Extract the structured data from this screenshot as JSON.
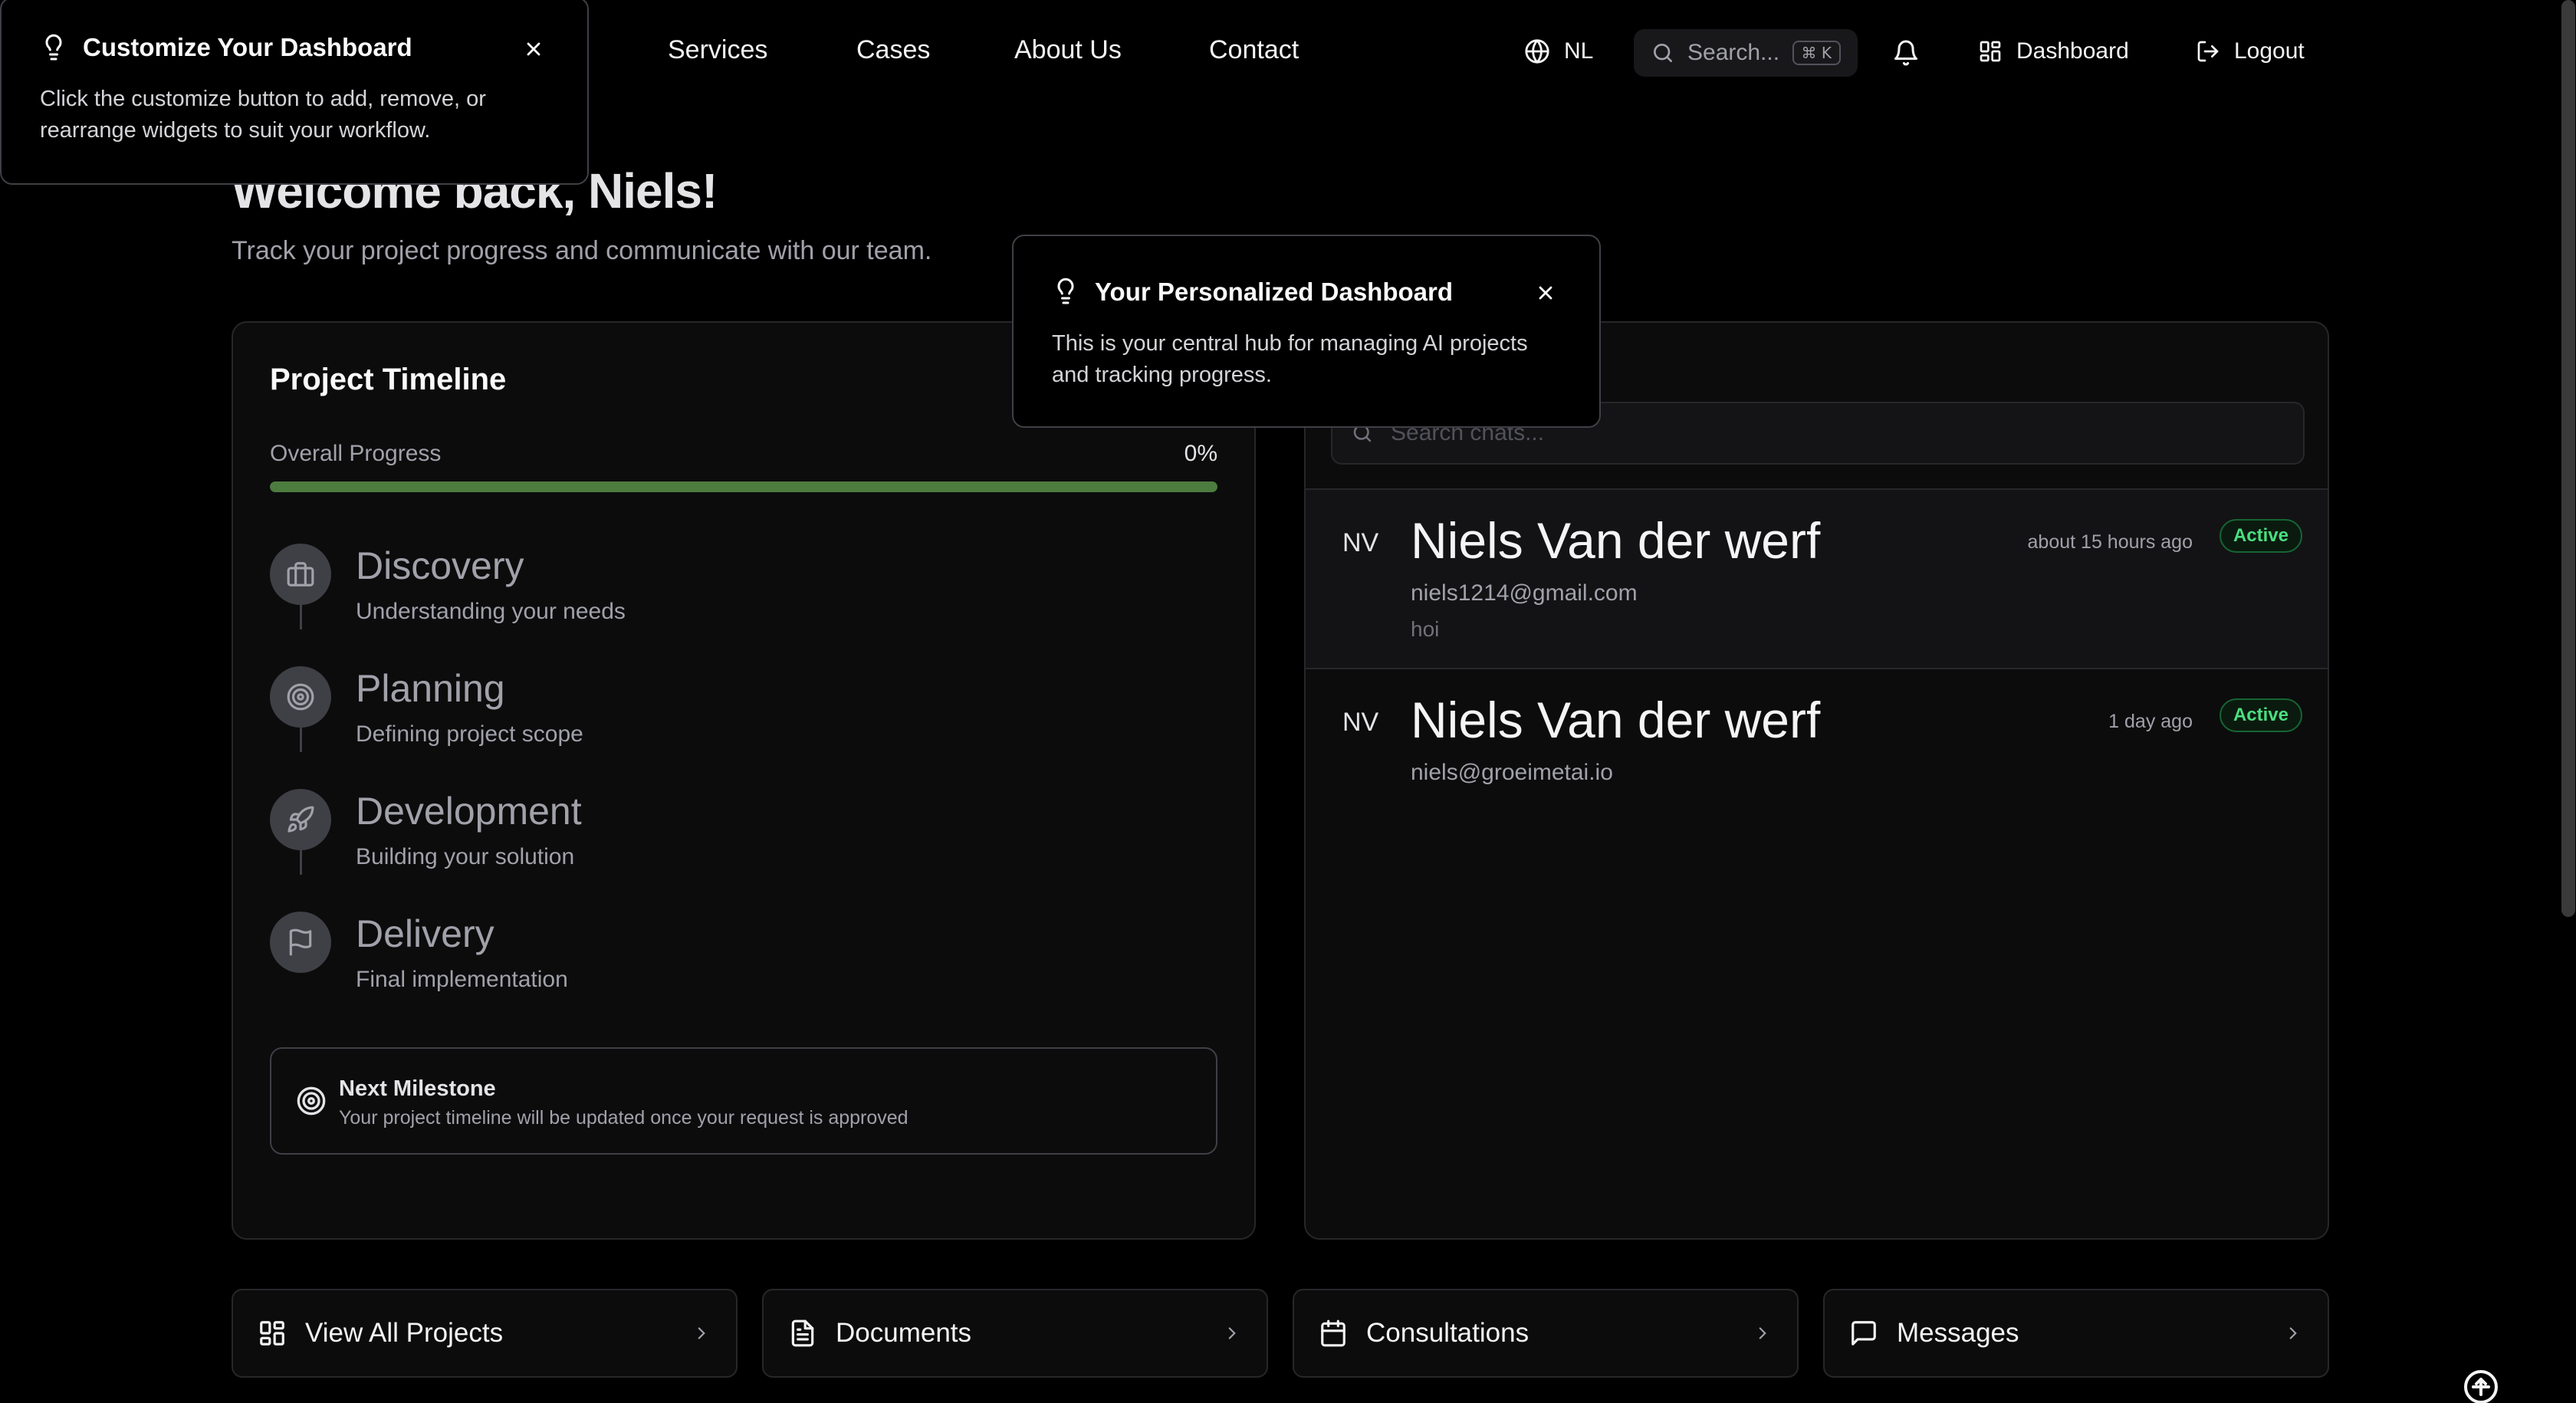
{
  "nav": {
    "links": [
      "Services",
      "Cases",
      "About Us",
      "Contact"
    ],
    "language": "NL",
    "search_placeholder": "Search...",
    "search_shortcut": "⌘ K",
    "dashboard_label": "Dashboard",
    "logout_label": "Logout"
  },
  "header": {
    "welcome": "Welcome back, Niels!",
    "subtitle": "Track your project progress and communicate with our team."
  },
  "timeline": {
    "title": "Project Timeline",
    "progress_label": "Overall Progress",
    "progress_text": "0%",
    "progress_fraction": 1.0,
    "steps": [
      {
        "title": "Discovery",
        "subtitle": "Understanding your needs",
        "icon": "briefcase-icon"
      },
      {
        "title": "Planning",
        "subtitle": "Defining project scope",
        "icon": "target-icon"
      },
      {
        "title": "Development",
        "subtitle": "Building your solution",
        "icon": "rocket-icon"
      },
      {
        "title": "Delivery",
        "subtitle": "Final implementation",
        "icon": "flag-icon"
      }
    ],
    "milestone": {
      "title": "Next Milestone",
      "subtitle": "Your project timeline will be updated once your request is approved"
    }
  },
  "chats": {
    "search_placeholder": "Search chats...",
    "items": [
      {
        "initials": "NV",
        "name": "Niels Van der werf",
        "email": "niels1214@gmail.com",
        "message": "hoi",
        "time": "about 15 hours ago",
        "status": "Active"
      },
      {
        "initials": "NV",
        "name": "Niels Van der werf",
        "email": "niels@groeimetai.io",
        "message": "",
        "time": "1 day ago",
        "status": "Active"
      }
    ]
  },
  "quick_links": [
    {
      "label": "View All Projects",
      "icon": "grid-icon"
    },
    {
      "label": "Documents",
      "icon": "document-icon"
    },
    {
      "label": "Consultations",
      "icon": "calendar-icon"
    },
    {
      "label": "Messages",
      "icon": "message-icon"
    }
  ],
  "popovers": {
    "customize": {
      "title": "Customize Your Dashboard",
      "body": "Click the customize button to add, remove, or rearrange widgets to suit your workflow."
    },
    "personalized": {
      "title": "Your Personalized Dashboard",
      "body": "This is your central hub for managing AI projects and tracking progress."
    }
  },
  "colors": {
    "accent_green": "#4d7c3f",
    "status_green": "#4ade80",
    "background": "#000000"
  }
}
